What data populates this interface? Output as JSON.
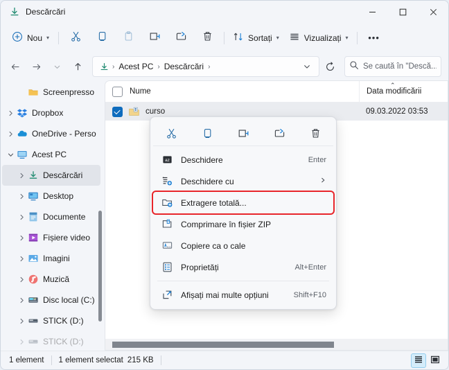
{
  "window": {
    "title": "Descărcări",
    "title_icon": "download-folder-icon",
    "minimize": "–",
    "maximize": "☐",
    "close": "✕"
  },
  "toolbar": {
    "new_label": "Nou",
    "new_icon": "plus-circle-icon",
    "cut_icon": "scissors-icon",
    "copy_icon": "copy-icon",
    "paste_icon": "paste-icon",
    "rename_icon": "rename-icon",
    "share_icon": "share-icon",
    "delete_icon": "trash-icon",
    "sort_label": "Sortați",
    "sort_icon": "sort-arrows-icon",
    "view_label": "Vizualizați",
    "view_icon": "view-lines-icon",
    "more_label": "•••",
    "chevron": "⌄"
  },
  "nav": {
    "back_icon": "arrow-left-icon",
    "forward_icon": "arrow-right-icon",
    "recent_icon": "chevron-down-icon",
    "up_icon": "arrow-up-icon",
    "refresh_icon": "refresh-icon",
    "address_chevron": "⌄",
    "path_icon": "download-icon",
    "crumbs": [
      "Acest PC",
      "Descărcări"
    ],
    "crumb_separator": "›",
    "trailing_separator": "›"
  },
  "search": {
    "icon": "search-icon",
    "placeholder": "Se caută în \"Descă...",
    "value": ""
  },
  "sidebar": {
    "items": [
      {
        "label": "Screenpresso",
        "icon": "folder-icon",
        "indent": 2,
        "twisty": "",
        "selected": false
      },
      {
        "label": "Dropbox",
        "icon": "dropbox-icon",
        "indent": 1,
        "twisty": "›",
        "selected": false
      },
      {
        "label": "OneDrive - Perso",
        "icon": "onedrive-icon",
        "indent": 1,
        "twisty": "›",
        "selected": false
      },
      {
        "label": "Acest PC",
        "icon": "pc-icon",
        "indent": 1,
        "twisty": "⌄",
        "selected": false
      },
      {
        "label": "Descărcări",
        "icon": "download-icon",
        "indent": 2,
        "twisty": "›",
        "selected": true
      },
      {
        "label": "Desktop",
        "icon": "desktop-icon",
        "indent": 2,
        "twisty": "›",
        "selected": false
      },
      {
        "label": "Documente",
        "icon": "documents-icon",
        "indent": 2,
        "twisty": "›",
        "selected": false
      },
      {
        "label": "Fișiere video",
        "icon": "video-icon",
        "indent": 2,
        "twisty": "›",
        "selected": false
      },
      {
        "label": "Imagini",
        "icon": "pictures-icon",
        "indent": 2,
        "twisty": "›",
        "selected": false
      },
      {
        "label": "Muzică",
        "icon": "music-icon",
        "indent": 2,
        "twisty": "›",
        "selected": false
      },
      {
        "label": "Disc local (C:)",
        "icon": "hard-drive-icon",
        "indent": 2,
        "twisty": "›",
        "selected": false
      },
      {
        "label": "STICK (D:)",
        "icon": "usb-drive-icon",
        "indent": 2,
        "twisty": "›",
        "selected": false
      },
      {
        "label": "STICK (D:)",
        "icon": "usb-drive-icon",
        "indent": 2,
        "twisty": "›",
        "selected": false
      }
    ]
  },
  "filelist": {
    "columns": {
      "name": "Nume",
      "date_modified": "Data modificării"
    },
    "sort_caret": "⌃",
    "rows": [
      {
        "name": "curso",
        "icon": "zip-archive-icon",
        "date_modified": "09.03.2022 03:53",
        "selected": true,
        "checked": true
      }
    ]
  },
  "context_menu": {
    "top_icons": [
      {
        "name": "cut-icon",
        "label": "Decupare"
      },
      {
        "name": "copy-icon",
        "label": "Copiere"
      },
      {
        "name": "rename-icon",
        "label": "Redenumire"
      },
      {
        "name": "share-icon",
        "label": "Partajare"
      },
      {
        "name": "delete-icon",
        "label": "Ștergere"
      }
    ],
    "items": [
      {
        "label": "Deschidere",
        "accel": "Enter",
        "icon": "open-zip-icon",
        "arrow": "",
        "highlighted": false,
        "divider_after": false
      },
      {
        "label": "Deschidere cu",
        "accel": "",
        "icon": "open-with-icon",
        "arrow": "›",
        "highlighted": false,
        "divider_after": false
      },
      {
        "label": "Extragere totală...",
        "accel": "",
        "icon": "extract-all-icon",
        "arrow": "",
        "highlighted": true,
        "divider_after": false
      },
      {
        "label": "Comprimare în fișier ZIP",
        "accel": "",
        "icon": "compress-zip-icon",
        "arrow": "",
        "highlighted": false,
        "divider_after": false
      },
      {
        "label": "Copiere ca o cale",
        "accel": "",
        "icon": "copy-path-icon",
        "arrow": "",
        "highlighted": false,
        "divider_after": false
      },
      {
        "label": "Proprietăți",
        "accel": "Alt+Enter",
        "icon": "properties-icon",
        "arrow": "",
        "highlighted": false,
        "divider_after": true
      },
      {
        "label": "Afișați mai multe opțiuni",
        "accel": "Shift+F10",
        "icon": "more-options-icon",
        "arrow": "",
        "highlighted": false,
        "divider_after": false
      }
    ]
  },
  "statusbar": {
    "item_count": "1 element",
    "selection": "1 element selectat",
    "size": "215 KB",
    "view_details_icon": "details-view-icon",
    "view_large_icon": "large-icons-view-icon"
  },
  "colors": {
    "accent": "#0f6cbd",
    "highlight_outline": "#e8252a",
    "selected_row": "#eaecf0",
    "window_bg": "#f3f5f9",
    "pane_bg": "#ffffff"
  }
}
